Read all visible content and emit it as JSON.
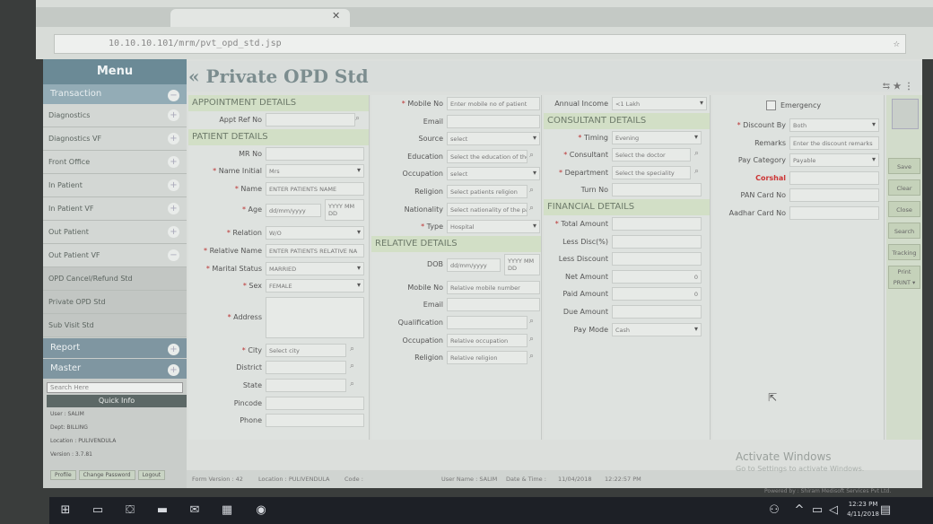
{
  "browser": {
    "url": "10.10.10.101/mrm/pvt_opd_std.jsp"
  },
  "menu": {
    "title": "Menu",
    "section": "Transaction",
    "items": [
      "Diagnostics",
      "Diagnostics VF",
      "Front Office",
      "In Patient",
      "In Patient VF",
      "Out Patient",
      "Out Patient VF"
    ],
    "subitems": [
      "OPD Cancel/Refund Std",
      "Private OPD Std",
      "Sub Visit Std"
    ],
    "report": "Report",
    "master": "Master",
    "search_placeholder": "Search Here"
  },
  "quickinfo": {
    "title": "Quick Info",
    "user": "User : SALIM",
    "dept": "Dept: BILLING",
    "location": "Location : PULIVENDULA",
    "version": "Version : 3.7.81",
    "btn_profile": "Profile",
    "btn_change": "Change Password",
    "btn_logout": "Logout"
  },
  "page": {
    "title": "« Private OPD Std"
  },
  "appt": {
    "head": "APPOINTMENT DETAILS",
    "ref_label": "Appt Ref No"
  },
  "patient": {
    "head": "PATIENT DETAILS",
    "mrno": "MR No",
    "name_initial": "Name Initial",
    "name_initial_val": "Mrs",
    "name": "Name",
    "name_ph": "ENTER PATIENTS NAME",
    "age": "Age",
    "age_ph": "dd/mm/yyyy",
    "age_ph2": "YYYY MM DD",
    "relation": "Relation",
    "relation_val": "W/O",
    "relative_name": "Relative Name",
    "relative_name_ph": "ENTER PATIENTS RELATIVE NA",
    "marital": "Marital Status",
    "marital_val": "MARRIED",
    "sex": "Sex",
    "sex_val": "FEMALE",
    "address": "Address",
    "city": "City",
    "city_ph": "Select city",
    "district": "District",
    "state": "State",
    "pincode": "Pincode",
    "phone": "Phone"
  },
  "contact": {
    "mobile": "Mobile No",
    "mobile_ph": "Enter mobile no of patient",
    "email": "Email",
    "source": "Source",
    "source_val": "select",
    "education": "Education",
    "education_ph": "Select the education of the",
    "occupation": "Occupation",
    "occupation_val": "select",
    "religion": "Religion",
    "religion_ph": "Select patients religion",
    "nationality": "Nationality",
    "nationality_ph": "Select nationality of the pa",
    "type": "Type",
    "type_val": "Hospital"
  },
  "relative": {
    "head": "RELATIVE DETAILS",
    "dob": "DOB",
    "dob_ph": "dd/mm/yyyy",
    "dob_ph2": "YYYY MM DD",
    "mobile": "Mobile No",
    "mobile_ph": "Relative mobile number",
    "email": "Email",
    "qualification": "Qualification",
    "occupation": "Occupation",
    "occupation_ph": "Relative occupation",
    "religion": "Religion",
    "religion_ph": "Relative religion"
  },
  "consultant": {
    "income": "Annual Income",
    "income_val": "<1 Lakh",
    "head": "CONSULTANT DETAILS",
    "timing": "Timing",
    "timing_val": "Evening",
    "consultant": "Consultant",
    "consultant_ph": "Select the doctor",
    "department": "Department",
    "department_ph": "Select the speciality",
    "turn": "Turn No"
  },
  "financial": {
    "head": "FINANCIAL DETAILS",
    "total": "Total Amount",
    "less_disc_pct": "Less Disc(%)",
    "less_disc": "Less Discount",
    "net": "Net Amount",
    "net_val": "0",
    "paid": "Paid Amount",
    "paid_val": "0",
    "due": "Due Amount",
    "paymode": "Pay Mode",
    "paymode_val": "Cash"
  },
  "discount": {
    "emergency": "Emergency",
    "discount_by": "Discount By",
    "discount_by_val": "Both",
    "remarks": "Remarks",
    "remarks_ph": "Enter the discount remarks",
    "pay_category": "Pay Category",
    "pay_category_val": "Payable",
    "corshal": "Corshal",
    "pan": "PAN Card No",
    "aadhar": "Aadhar Card No"
  },
  "actions": {
    "save": "Save",
    "clear": "Clear",
    "close": "Close",
    "search": "Search",
    "tracking": "Tracking",
    "print": "Print",
    "print_sel": "PRINT"
  },
  "footer": {
    "form_version": "Form Version : 42",
    "location": "Location : PULIVENDULA",
    "code": "Code :",
    "username": "User Name : SALIM",
    "datetime_label": "Date & Time :",
    "date": "11/04/2018",
    "time": "12:22:57 PM"
  },
  "os": {
    "watermark": "Activate Windows",
    "watermark2": "Go to Settings to activate Windows.",
    "powered": "Powered by : Shiram Medisoft Services Pvt Ltd.",
    "clock_time": "12:23 PM",
    "clock_date": "4/11/2018"
  }
}
